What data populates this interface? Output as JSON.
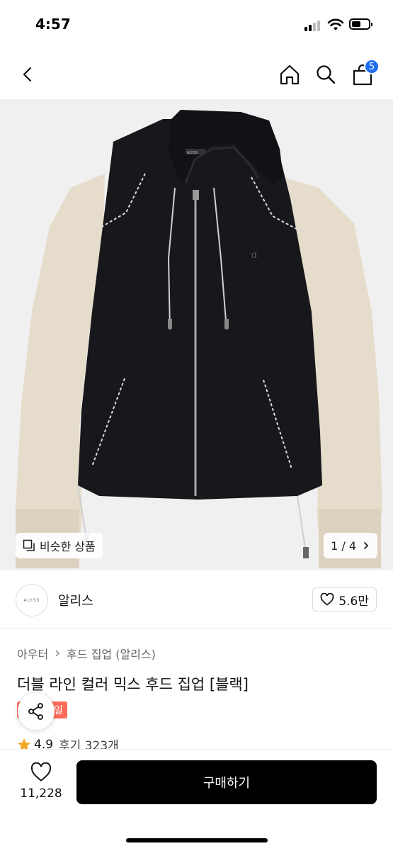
{
  "status": {
    "time": "4:57"
  },
  "nav": {
    "cart_count": "5"
  },
  "image": {
    "similar_label": "비슷한 상품",
    "pager": "1 / 4",
    "garment_label": "ALYSS"
  },
  "brand": {
    "logo_text": "ALYSS",
    "name": "알리스",
    "likes": "5.6만"
  },
  "product": {
    "breadcrumb": [
      "아우터",
      "후드 집업 (알리스)"
    ],
    "title": "더블 라인 컬러 믹스 후드 집업 [블랙]",
    "badge": "일",
    "rating": "4.9",
    "reviews": "후기 323개"
  },
  "bottom": {
    "wish_count": "11,228",
    "buy_label": "구매하기"
  },
  "colors": {
    "accent": "#1e6ef4",
    "sale": "#ff6b5a",
    "star": "#f5a623"
  }
}
